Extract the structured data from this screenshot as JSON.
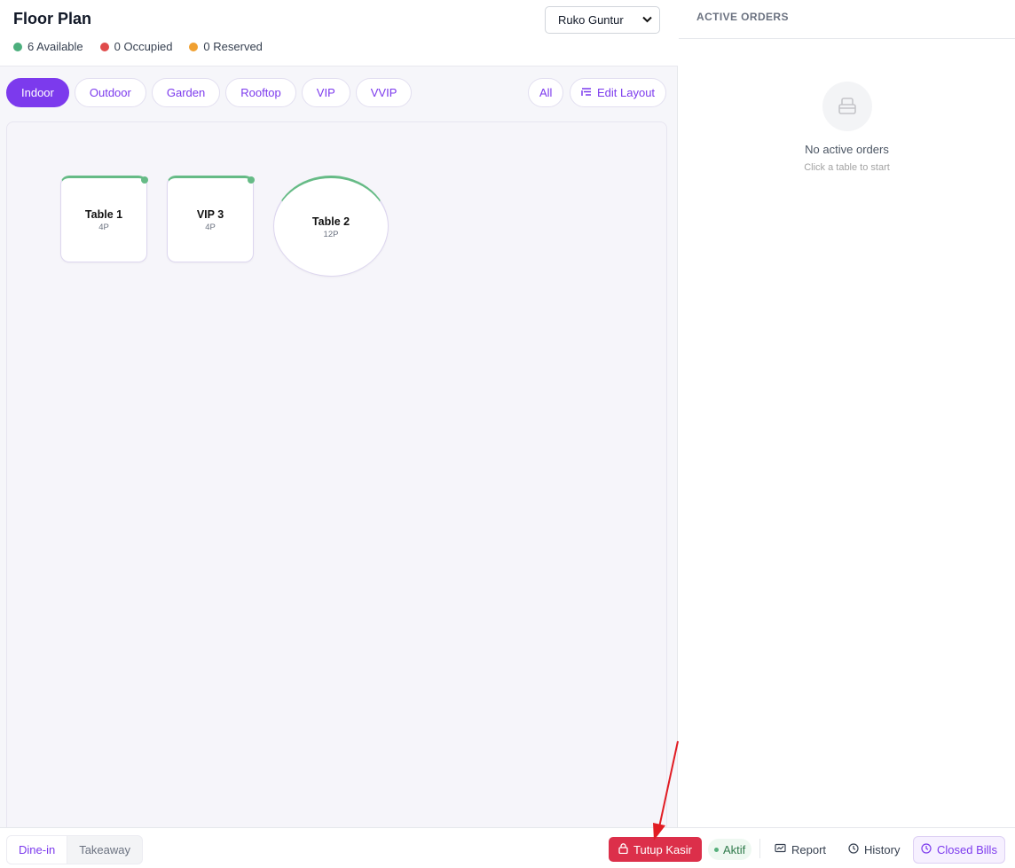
{
  "header": {
    "title": "Floor Plan",
    "legend": [
      {
        "label": "6 Available",
        "color": "#4caf7d"
      },
      {
        "label": "0 Occupied",
        "color": "#e04b4b"
      },
      {
        "label": "0 Reserved",
        "color": "#f0a030"
      }
    ],
    "location_select": {
      "value": "Ruko Guntur"
    }
  },
  "area_tabs": [
    {
      "label": "Indoor",
      "active": true
    },
    {
      "label": "Outdoor",
      "active": false
    },
    {
      "label": "Garden",
      "active": false
    },
    {
      "label": "Rooftop",
      "active": false
    },
    {
      "label": "VIP",
      "active": false
    },
    {
      "label": "VVIP",
      "active": false
    }
  ],
  "toolbar": {
    "all_label": "All",
    "edit_layout_label": "Edit Layout"
  },
  "tables": [
    {
      "name": "Table 1",
      "capacity": "4P",
      "shape": "square",
      "status_color": "#66bb86"
    },
    {
      "name": "VIP 3",
      "capacity": "4P",
      "shape": "square",
      "status_color": "#66bb86"
    },
    {
      "name": "Table 2",
      "capacity": "12P",
      "shape": "round",
      "status_color": "#66bb86"
    }
  ],
  "active_orders": {
    "title": "ACTIVE ORDERS",
    "empty_title": "No active orders",
    "empty_subtitle": "Click a table to start"
  },
  "bottom_bar": {
    "modes": [
      {
        "label": "Dine-in",
        "active": true
      },
      {
        "label": "Takeaway",
        "active": false
      }
    ],
    "tutup_kasir_label": "Tutup Kasir",
    "status_label": "Aktif",
    "report_label": "Report",
    "history_label": "History",
    "closed_bills_label": "Closed Bills"
  },
  "colors": {
    "accent": "#7c3aed",
    "danger": "#dc2f4a",
    "available": "#66bb86"
  }
}
